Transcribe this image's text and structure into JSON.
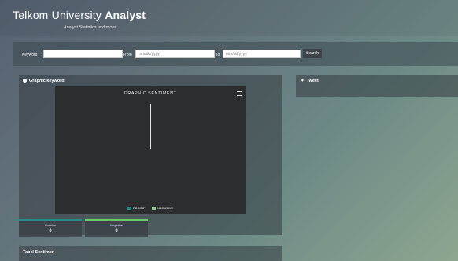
{
  "header": {
    "brand_light": "Telkom University ",
    "brand_bold": "Analyst",
    "tagline": "Analyst Statistics and more"
  },
  "search": {
    "keyword_label": "Keyword :",
    "keyword_value": "",
    "from_label": "From",
    "from_placeholder": "mm/dd/yyyy",
    "to_label": "To",
    "to_placeholder": "mm/dd/yyyy",
    "search_label": "Search"
  },
  "graphic_panel": {
    "title": "Graphic keyword",
    "chart_title": "GRAPHIC SENTIMENT"
  },
  "chart_data": {
    "type": "bar",
    "title": "GRAPHIC SENTIMENT",
    "series": [
      {
        "name": "POSITIF",
        "color": "#2a8a8a",
        "values": [
          0
        ]
      },
      {
        "name": "NEGATIVE",
        "color": "#7fd07f",
        "values": [
          0
        ]
      }
    ]
  },
  "stats": {
    "positive_label": "Positive",
    "positive_value": "0",
    "positive_color": "#2a8a8a",
    "negative_label": "Negative",
    "negative_value": "0",
    "negative_color": "#6fc46f"
  },
  "tweet_panel": {
    "title": "Tweet",
    "icon": "twitter-icon"
  },
  "table_panel": {
    "title": "Tabel Sentimen"
  }
}
